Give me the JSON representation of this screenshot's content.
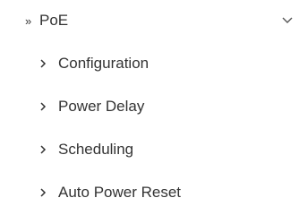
{
  "menu": {
    "group": {
      "label": "PoE",
      "prefix_icon": "double-chevron-right-icon",
      "expand_icon": "chevron-down-icon",
      "expanded": true
    },
    "items": [
      {
        "label": "Configuration",
        "icon": "chevron-right-icon"
      },
      {
        "label": "Power Delay",
        "icon": "chevron-right-icon"
      },
      {
        "label": "Scheduling",
        "icon": "chevron-right-icon"
      },
      {
        "label": "Auto Power Reset",
        "icon": "chevron-right-icon"
      }
    ]
  },
  "colors": {
    "text": "#333333",
    "background": "#ffffff"
  }
}
